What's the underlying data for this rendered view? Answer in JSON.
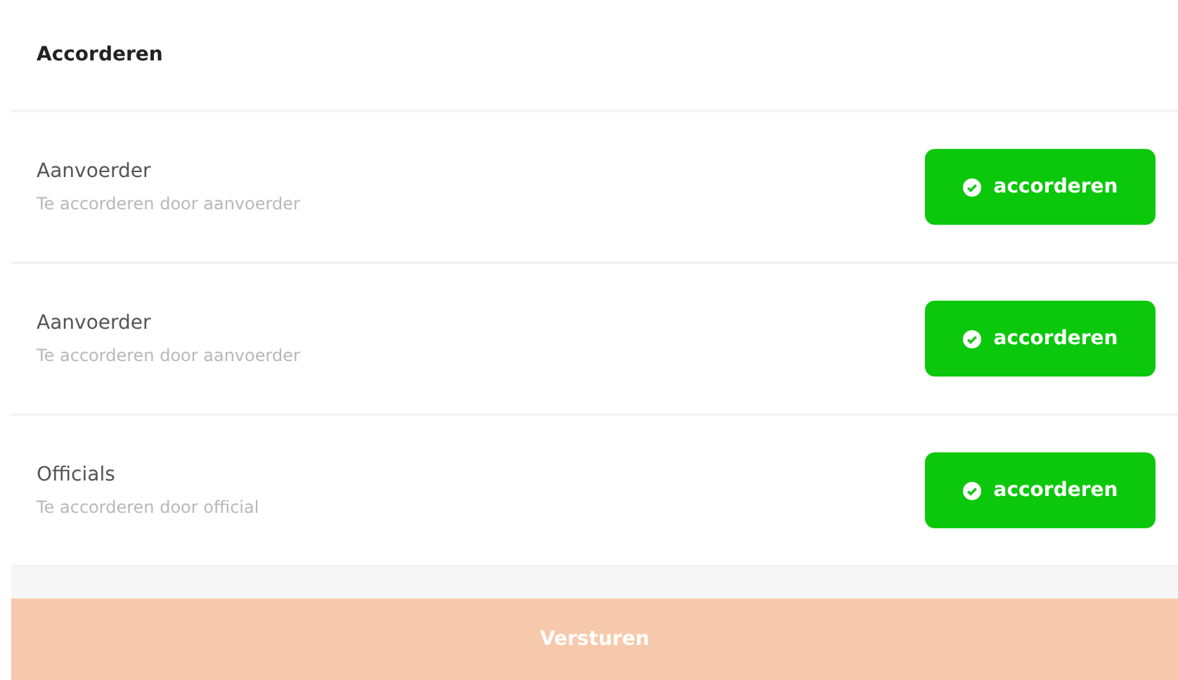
{
  "title": "Accorderen",
  "approvals": [
    {
      "role": "Aanvoerder",
      "description": "Te accorderen door aanvoerder",
      "button": "accorderen"
    },
    {
      "role": "Aanvoerder",
      "description": "Te accorderen door aanvoerder",
      "button": "accorderen"
    },
    {
      "role": "Officials",
      "description": "Te accorderen door official",
      "button": "accorderen"
    }
  ],
  "submit": {
    "label": "Versturen",
    "disabled": true
  }
}
